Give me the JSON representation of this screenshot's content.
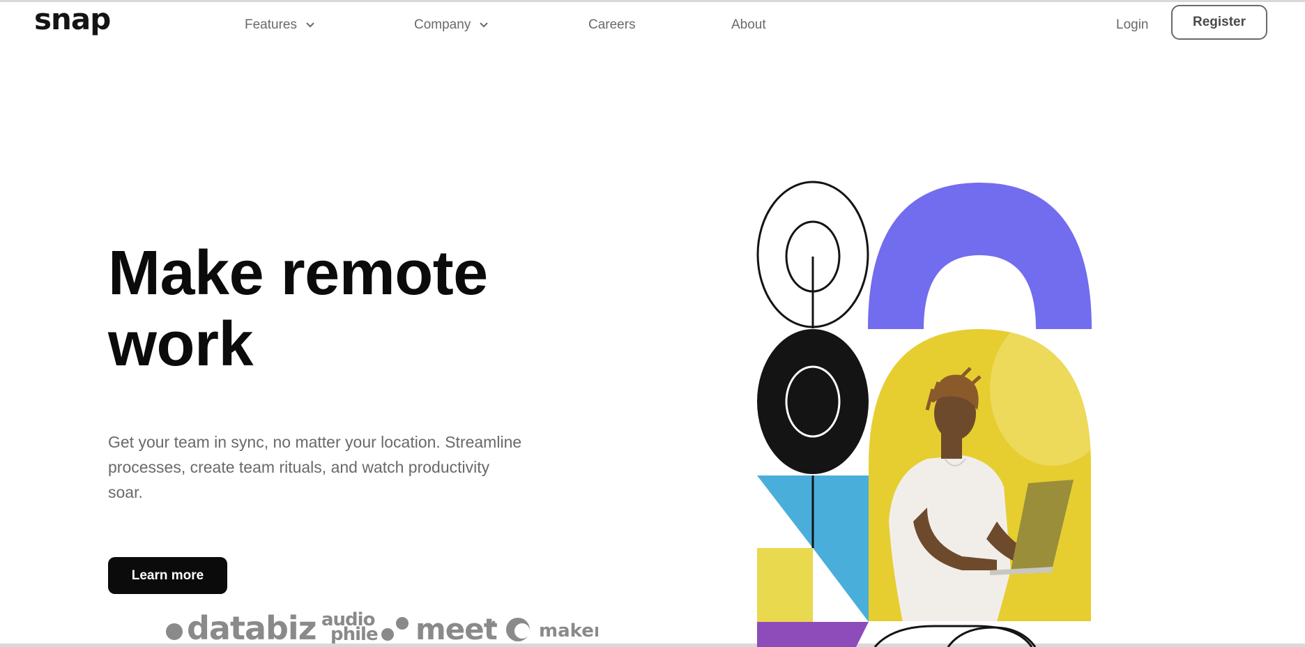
{
  "header": {
    "logo": "snap",
    "nav": [
      {
        "label": "Features",
        "has_dropdown": true,
        "icon": "chevron-down-icon"
      },
      {
        "label": "Company",
        "has_dropdown": true,
        "icon": "chevron-down-icon"
      },
      {
        "label": "Careers",
        "has_dropdown": false
      },
      {
        "label": "About",
        "has_dropdown": false
      }
    ],
    "login_label": "Login",
    "register_label": "Register"
  },
  "hero": {
    "headline": "Make remote work",
    "subtext": "Get your team in sync, no matter your location. Streamline processes, create team rituals, and watch productivity soar.",
    "cta_label": "Learn more",
    "clients": [
      "databiz",
      "audiophile",
      "meet",
      "maker"
    ],
    "image": "person-with-laptop-photo"
  },
  "colors": {
    "text_dark": "#0b0b0b",
    "text_gray": "#696969",
    "purple": "#726cee",
    "yellow": "#e9d94f",
    "blue": "#4aaedb",
    "violet": "#8e4cba",
    "white": "#ffffff"
  }
}
